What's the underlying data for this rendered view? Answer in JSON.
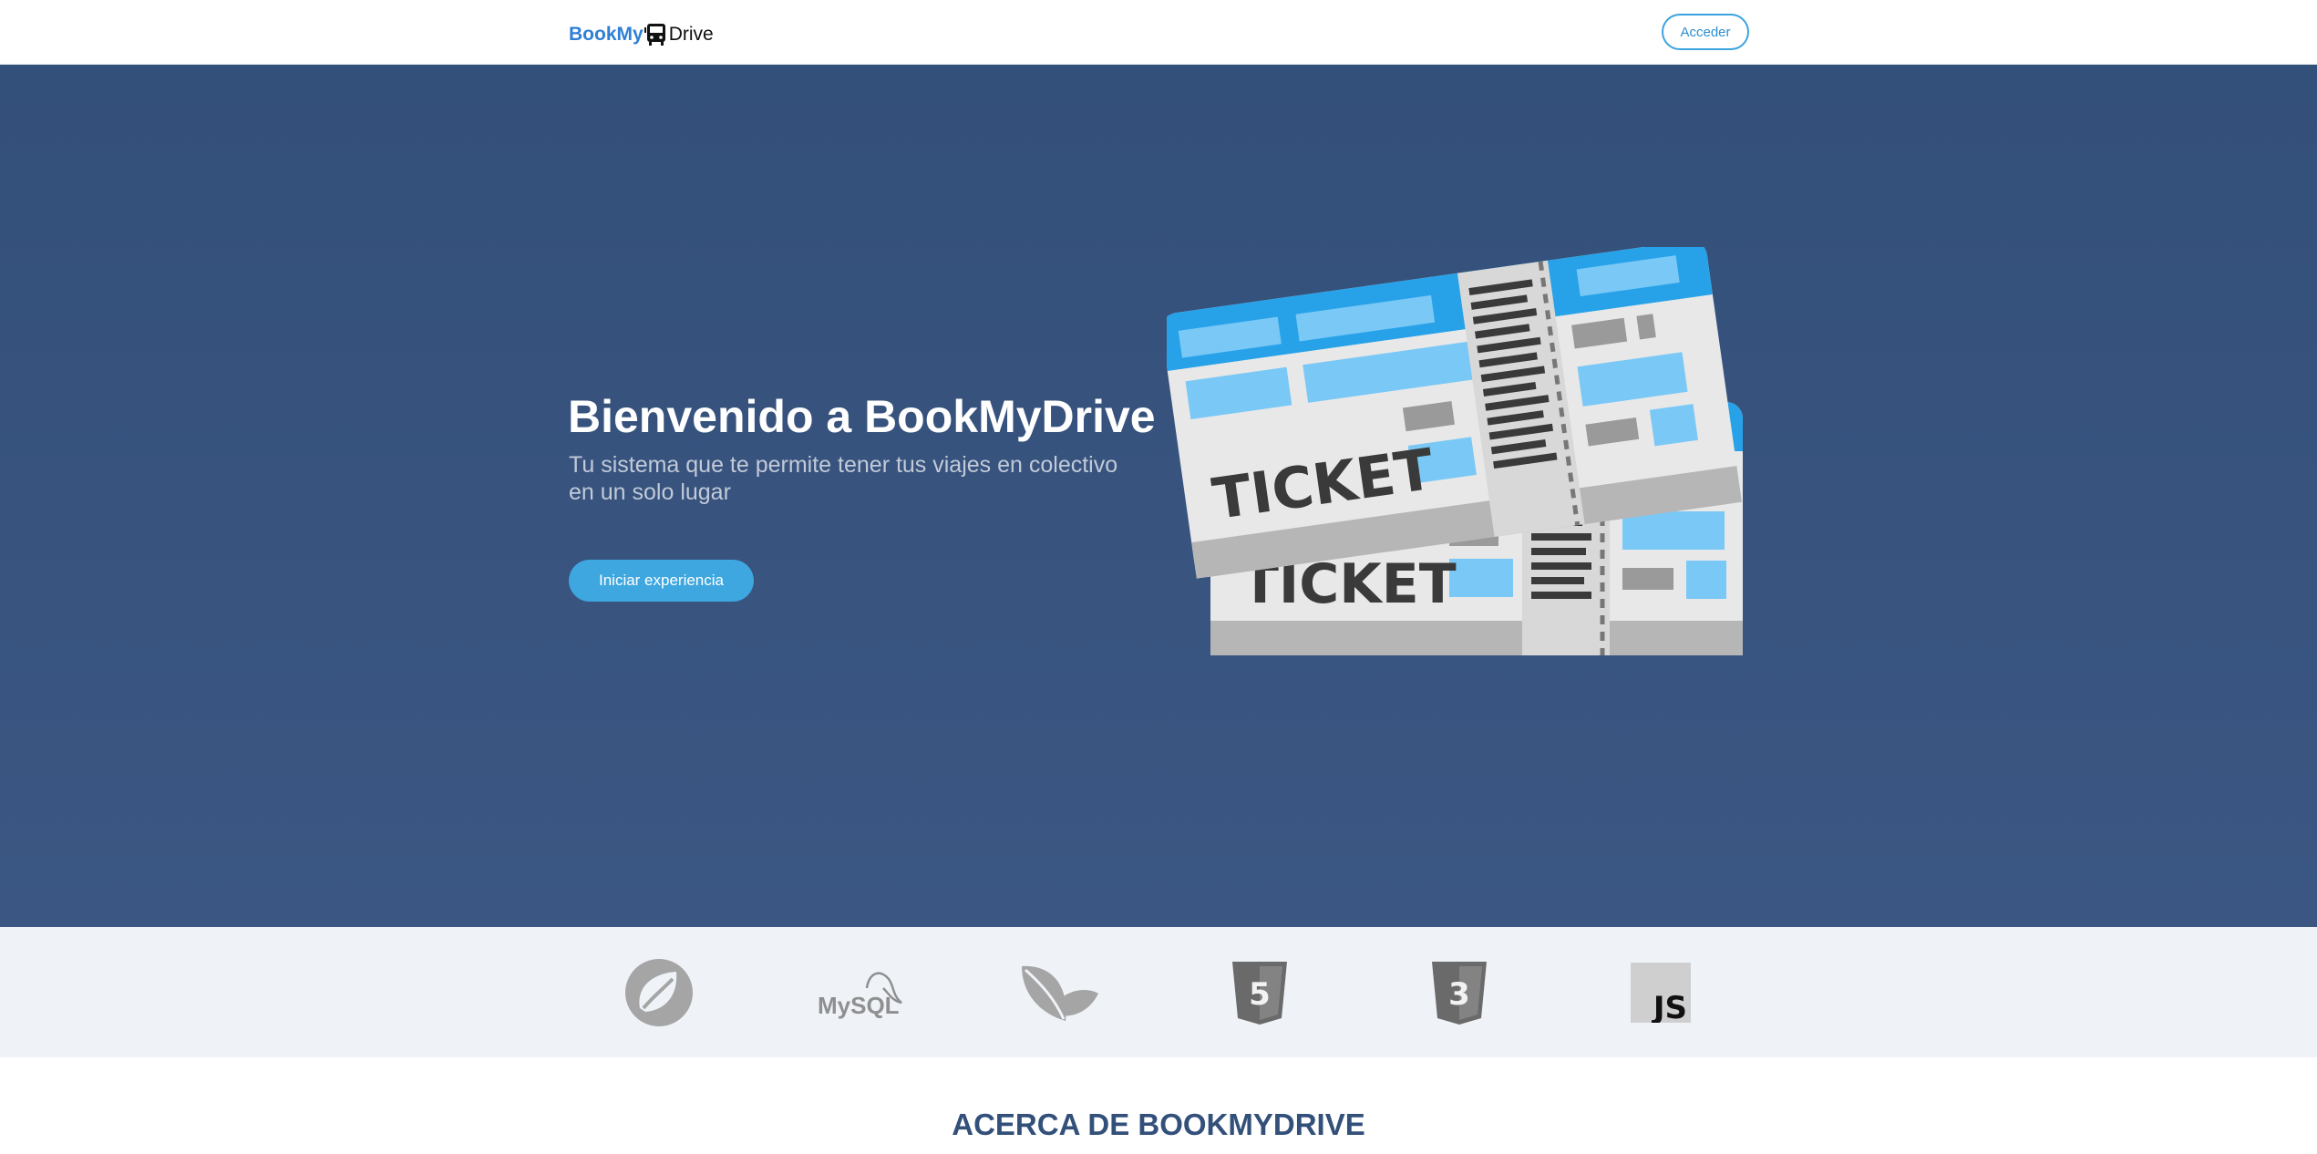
{
  "navbar": {
    "brand_part1": "BookMy",
    "brand_icon": "bus-icon",
    "brand_part2": "Drive",
    "login_label": "Acceder"
  },
  "hero": {
    "title": "Bienvenido a BookMyDrive",
    "subtitle": "Tu sistema que te permite tener tus viajes en colectivo en un solo lugar",
    "cta_label": "Iniciar experiencia",
    "illustration": "tickets-illustration",
    "ticket_text": "TICKET"
  },
  "tech_logos": [
    {
      "name": "spring-logo"
    },
    {
      "name": "mysql-logo",
      "label": "MySQL"
    },
    {
      "name": "thymeleaf-logo"
    },
    {
      "name": "html5-logo",
      "label": "5"
    },
    {
      "name": "css3-logo",
      "label": "3"
    },
    {
      "name": "javascript-logo",
      "label": "JS"
    }
  ],
  "about": {
    "title": "ACERCA DE BOOKMYDRIVE"
  },
  "colors": {
    "brand_blue": "#2f7fd6",
    "hero_bg": "#374f7a",
    "accent": "#3ea7e0",
    "strip_bg": "#eff3f8",
    "about_title": "#33507a"
  }
}
